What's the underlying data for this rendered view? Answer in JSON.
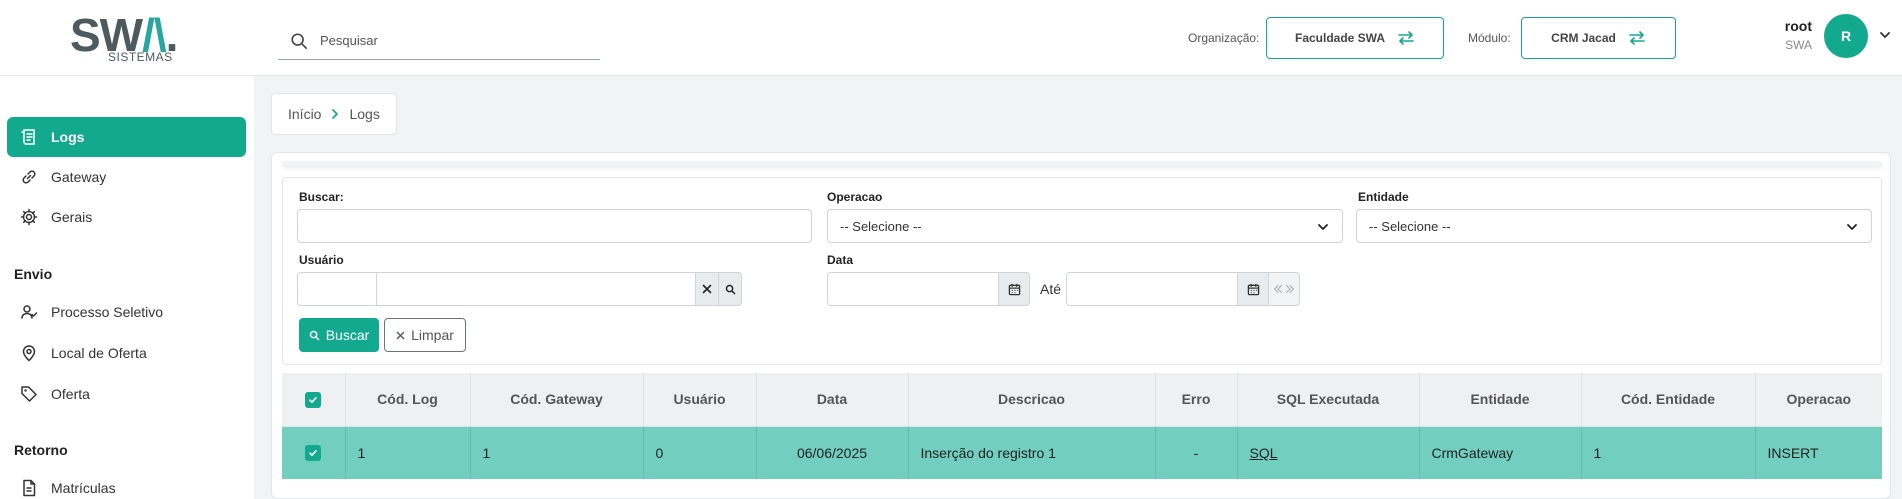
{
  "header": {
    "logo_text": "SWA.",
    "logo_sub": "SISTEMAS",
    "search_placeholder": "Pesquisar",
    "org_label": "Organização:",
    "org_value": "Faculdade SWA",
    "module_label": "Módulo:",
    "module_value": "CRM Jacad",
    "user_name": "root",
    "user_org": "SWA",
    "avatar_letter": "R"
  },
  "sidebar": {
    "items": [
      {
        "label": "Logs",
        "icon": "scroll-icon",
        "active": true
      },
      {
        "label": "Gateway",
        "icon": "link-icon"
      },
      {
        "label": "Gerais",
        "icon": "gear-icon"
      }
    ],
    "sections": [
      {
        "title": "Envio",
        "items": [
          {
            "label": "Processo Seletivo",
            "icon": "users-icon"
          },
          {
            "label": "Local de Oferta",
            "icon": "map-pin-icon"
          },
          {
            "label": "Oferta",
            "icon": "tag-icon"
          }
        ]
      },
      {
        "title": "Retorno",
        "items": [
          {
            "label": "Matrículas",
            "icon": "document-icon"
          }
        ]
      }
    ]
  },
  "breadcrumb": {
    "home": "Início",
    "current": "Logs"
  },
  "filters": {
    "buscar_label": "Buscar:",
    "operacao_label": "Operacao",
    "operacao_value": "-- Selecione --",
    "entidade_label": "Entidade",
    "entidade_value": "-- Selecione --",
    "usuario_label": "Usuário",
    "data_label": "Data",
    "ate_label": "Até",
    "buscar_btn": "Buscar",
    "limpar_btn": "Limpar"
  },
  "table": {
    "headers": [
      "Cód. Log",
      "Cód. Gateway",
      "Usuário",
      "Data",
      "Descricao",
      "Erro",
      "SQL Executada",
      "Entidade",
      "Cód. Entidade",
      "Operacao"
    ],
    "rows": [
      {
        "cod_log": "1",
        "cod_gateway": "1",
        "usuario": "0",
        "data": "06/06/2025",
        "descricao": "Inserção do registro 1",
        "erro": "-",
        "sql": "SQL",
        "entidade": "CrmGateway",
        "cod_entidade": "1",
        "operacao": "INSERT"
      }
    ]
  },
  "colors": {
    "accent": "#12a98f",
    "row_selected": "#72cfc0"
  }
}
